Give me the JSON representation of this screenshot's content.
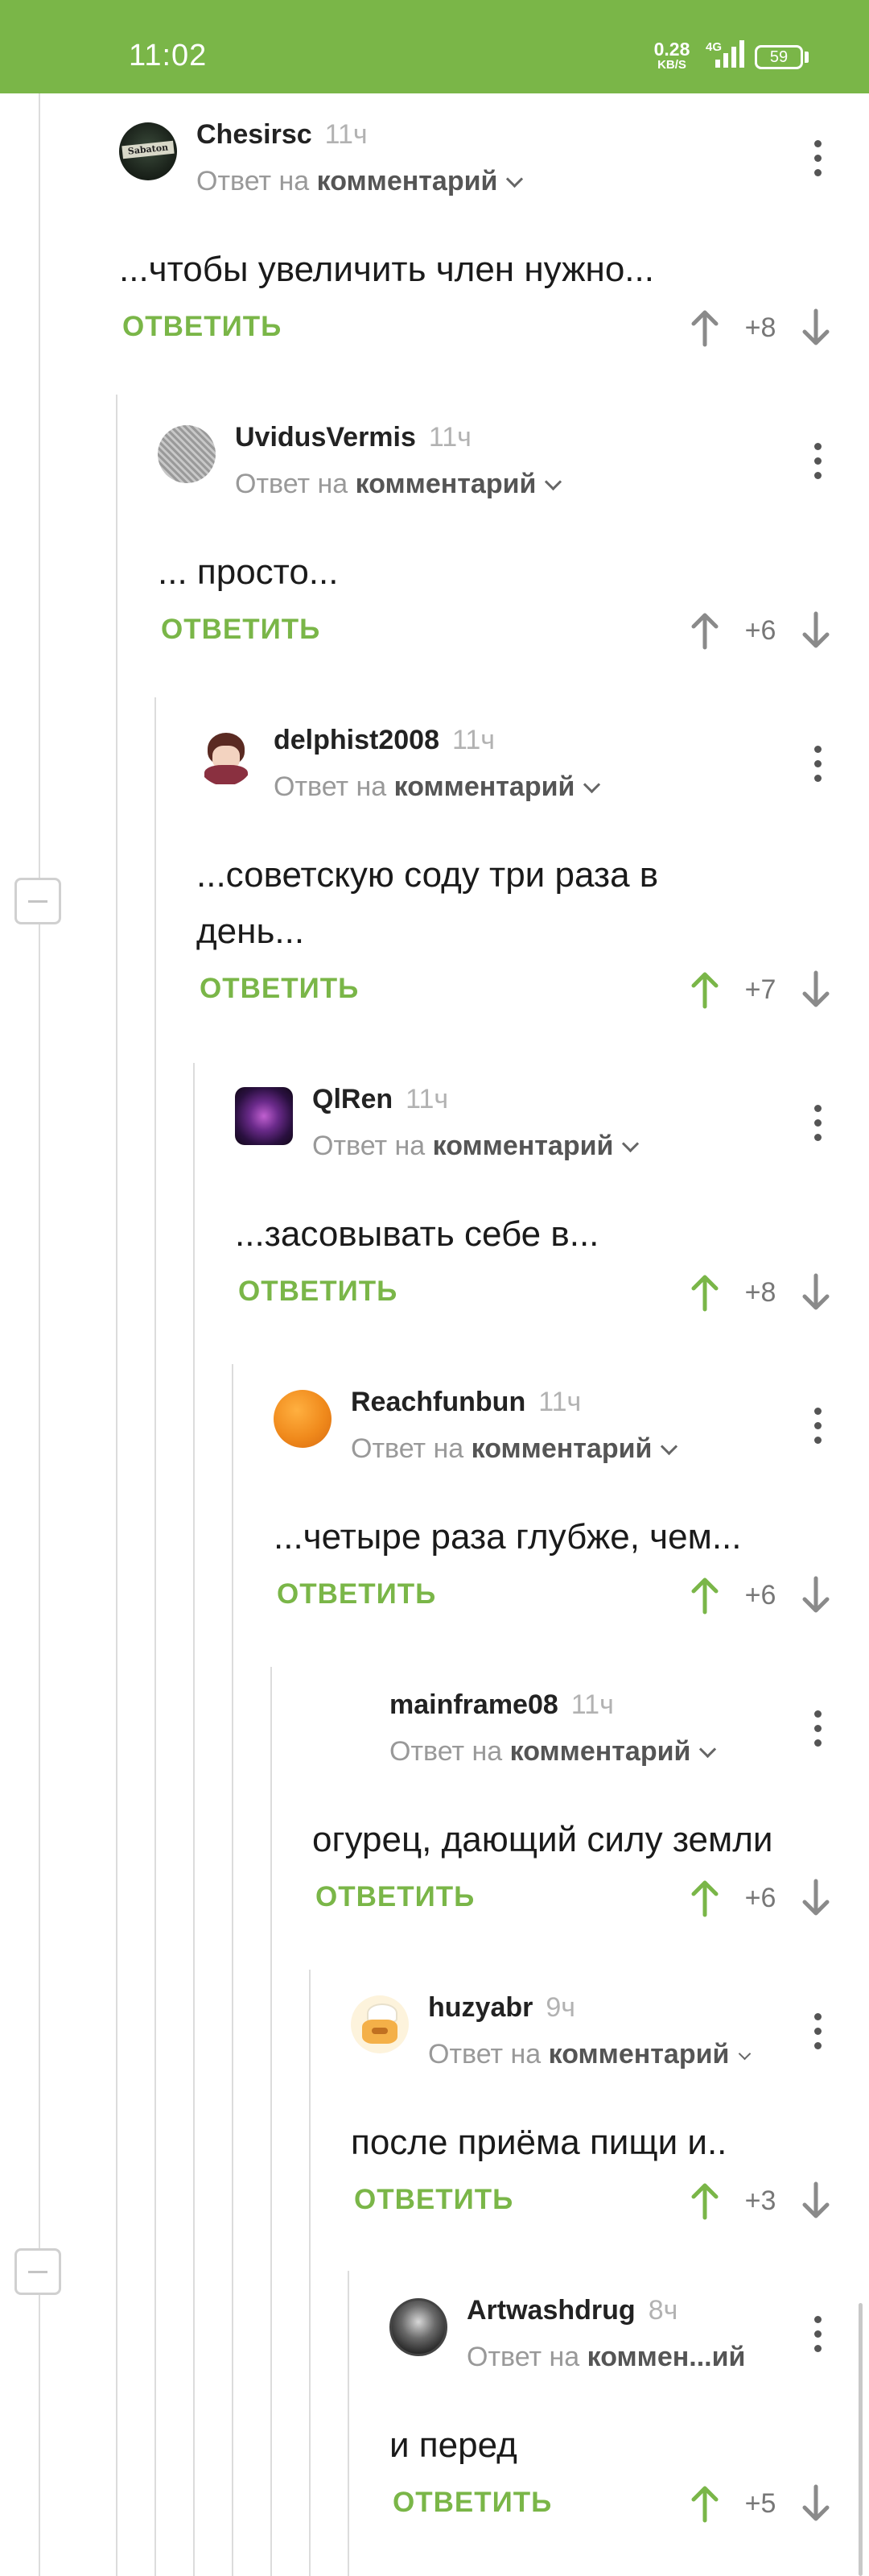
{
  "status_bar": {
    "time": "11:02",
    "speed_value": "0.28",
    "speed_unit": "KB/S",
    "network": "4G",
    "battery": "59"
  },
  "common": {
    "reply_prefix": "Ответ на",
    "reply_target": "комментарий",
    "reply_button": "ОТВЕТИТЬ"
  },
  "comments": [
    {
      "author": "Chesirsc",
      "time": "11ч",
      "text": "...чтобы увеличить член нужно...",
      "score": "+8",
      "upvoted": false,
      "avatar": "sabaton-logo"
    },
    {
      "author": "UvidusVermis",
      "time": "11ч",
      "text": "... просто...",
      "score": "+6",
      "upvoted": false,
      "avatar": "gray-pattern"
    },
    {
      "author": "delphist2008",
      "time": "11ч",
      "text_line1": "...советскую соду три раза в",
      "text_line2": "день...",
      "score": "+7",
      "upvoted": true,
      "avatar": "anime-character"
    },
    {
      "author": "QlRen",
      "time": "11ч",
      "text": "...засовывать себе в...",
      "score": "+8",
      "upvoted": true,
      "avatar": "purple-swirl"
    },
    {
      "author": "Reachfunbun",
      "time": "11ч",
      "text": "...четыре раза глубже, чем...",
      "score": "+6",
      "upvoted": true,
      "avatar": "orange-circle"
    },
    {
      "author": "mainframe08",
      "time": "11ч",
      "text": "огурец, дающий силу земли",
      "score": "+6",
      "upvoted": true,
      "avatar": "none"
    },
    {
      "author": "huzyabr",
      "time": "9ч",
      "text": "после приёма пищи и..",
      "score": "+3",
      "upvoted": true,
      "avatar": "cartoon-cook"
    },
    {
      "author": "Artwashdrug",
      "time": "8ч",
      "reply_truncated": "коммен...ий",
      "text": "и перед",
      "score": "+5",
      "upvoted": true,
      "avatar": "dark-portrait"
    }
  ],
  "colors": {
    "accent": "#7ab648",
    "arrow_neutral": "#8a8a8a",
    "thread_line": "#dcdcdc"
  }
}
